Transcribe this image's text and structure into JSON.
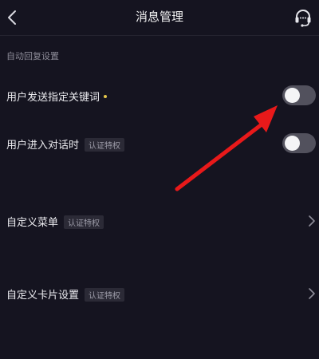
{
  "header": {
    "title": "消息管理",
    "back_icon": "chevron-left-icon",
    "support_icon": "headset-icon"
  },
  "section": {
    "label": "自动回复设置"
  },
  "rows": [
    {
      "label": "用户发送指定关键词",
      "has_dot": true,
      "control": "toggle",
      "enabled": false
    },
    {
      "label": "用户进入对话时",
      "badge": "认证特权",
      "control": "toggle",
      "enabled": false
    },
    {
      "label": "自定义菜单",
      "badge": "认证特权",
      "control": "chevron"
    },
    {
      "label": "自定义卡片设置",
      "badge": "认证特权",
      "control": "chevron"
    }
  ],
  "colors": {
    "background": "#151420",
    "toggle_off": "#52515d",
    "dot": "#e4c64a",
    "annotation_arrow": "#e8191a"
  }
}
